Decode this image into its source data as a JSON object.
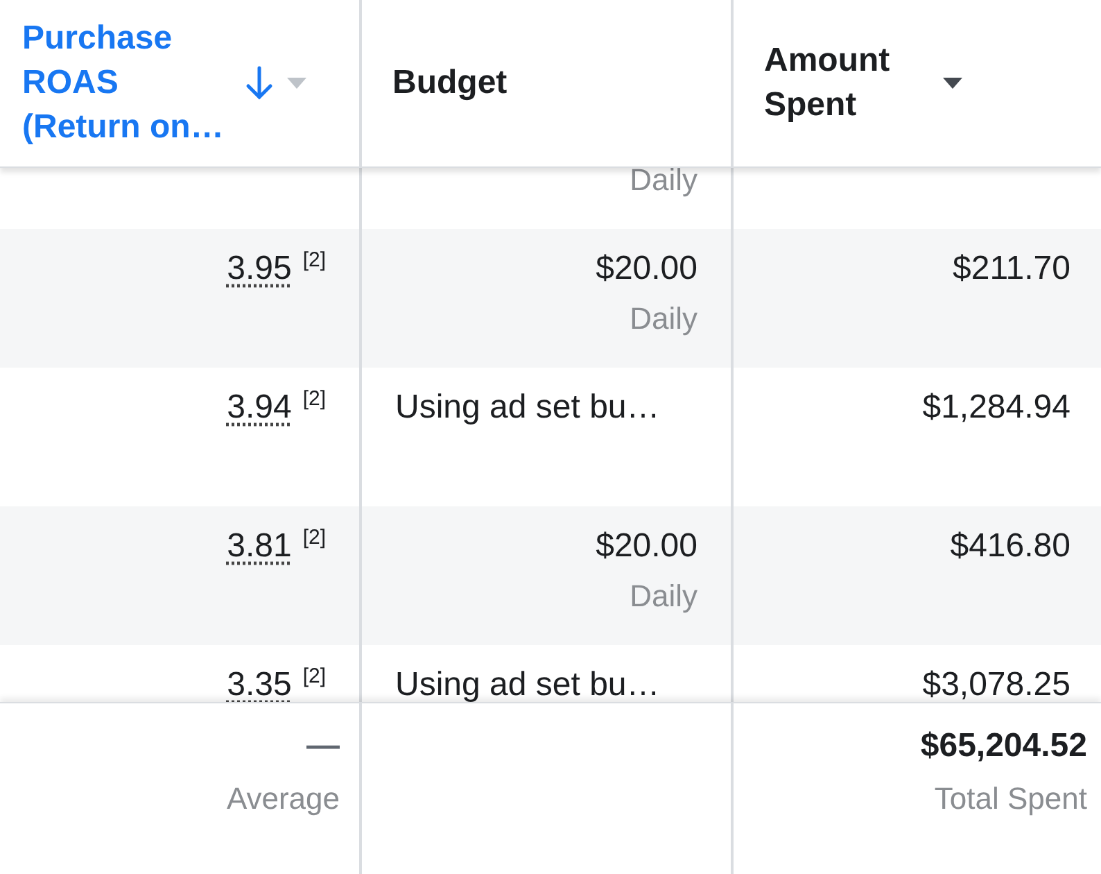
{
  "columns": [
    {
      "label": "Purchase ROAS (Return on…",
      "sorted": true,
      "menu": true
    },
    {
      "label": "Budget",
      "sorted": false,
      "menu": false
    },
    {
      "label": "Amount Spent",
      "sorted": false,
      "menu": true
    }
  ],
  "rows": [
    {
      "budget_note": "Daily"
    },
    {
      "roas": "3.95",
      "note": "[2]",
      "budget": "$20.00",
      "budget_note": "Daily",
      "amount": "$211.70"
    },
    {
      "roas": "3.94",
      "note": "[2]",
      "budget": "Using ad set bu…",
      "amount": "$1,284.94"
    },
    {
      "roas": "3.81",
      "note": "[2]",
      "budget": "$20.00",
      "budget_note": "Daily",
      "amount": "$416.80"
    },
    {
      "roas": "3.35",
      "note": "[2]",
      "budget": "Using ad set bu…",
      "amount": "$3,078.25"
    }
  ],
  "footer": {
    "average": {
      "value": "—",
      "label": "Average"
    },
    "total": {
      "value": "$65,204.52",
      "label": "Total Spent"
    }
  }
}
